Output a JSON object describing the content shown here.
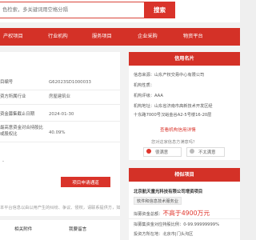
{
  "search": {
    "placeholder": "色检索，多关键词用空格分隔",
    "button_label": "搜索"
  },
  "nav": {
    "items": [
      "产权项目",
      "行业机构",
      "服务项目",
      "企业采购",
      "物资平台"
    ]
  },
  "detail": {
    "rows": [
      {
        "label": "目编号",
        "value": "G62023SD1000033"
      },
      {
        "label": "资方所属行业",
        "value": "房屋建筑业"
      },
      {
        "label": "资金募集截止日期",
        "value": "2024-01-30"
      },
      {
        "label": "最高意资金对合持股比",
        "value": "40.09%"
      },
      {
        "label": "或股权比",
        "value": ""
      }
    ],
    "dash_value": "-",
    "apply_button": "项目申请通道",
    "notice_text": "本平台信息以由以用产生的纠纷、争议、侵权，请联系提供方，如联由"
  },
  "tabs": [
    "相关附件",
    "我要留言"
  ],
  "org_card": {
    "header": "信用名片",
    "lines": [
      "信息来源：山东产权交易中心有限公司",
      "机构性质：",
      "机构评级：AAA",
      "机构地址：山东省济南市高新技术开发区经",
      "十东路7000号汉峪金谷A2-5号楼16-20层"
    ],
    "link": "查看机构信用详情",
    "question": "您对这家信息方满意吗？",
    "satisfied": "很满意",
    "unsatisfied": "不太满意"
  },
  "project_card": {
    "header": "相似项目",
    "title": "北京航天童光科技有限公司增资项目",
    "tag": "软件和信息技术服务业",
    "raise_label": "拟募资金总额：",
    "raise_value": "不高于4900万元",
    "share_line": "拟募集资金对应持股比例：0-99.99999999%",
    "region_line": "投资方所在地：北京市|门头沟区"
  }
}
